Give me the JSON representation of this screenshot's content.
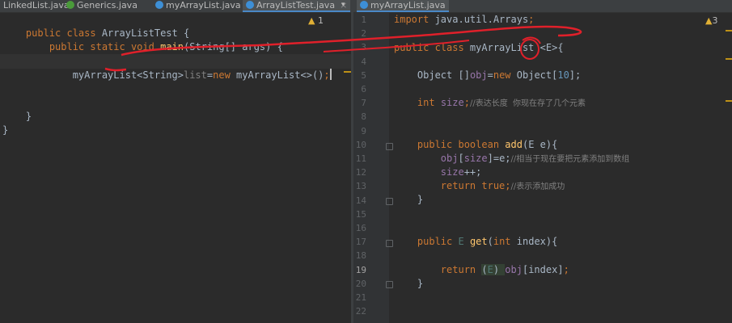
{
  "left_tabs": [
    {
      "label": "LinkedList.java",
      "icon": "java-class-icon"
    },
    {
      "label": "Generics.java",
      "icon": "java-generic-icon"
    },
    {
      "label": "myArrayList.java",
      "icon": "java-class-icon"
    },
    {
      "label": "ArrayListTest.java",
      "icon": "java-class-icon",
      "active": true,
      "close": "×"
    }
  ],
  "right_tabs": [
    {
      "label": "myArrayList.java",
      "icon": "java-class-icon",
      "active": true
    }
  ],
  "left_editor": {
    "warnings": "1",
    "lines": [
      "public class ArrayListTest {",
      "    public static void main(String[] args) {",
      "",
      "        myArrayList<String>list=new myArrayList<>();",
      "",
      "",
      "",
      "    }",
      "}"
    ]
  },
  "right_editor": {
    "warnings": "3",
    "line_numbers": [
      "1",
      "2",
      "3",
      "4",
      "5",
      "6",
      "7",
      "8",
      "9",
      "10",
      "11",
      "12",
      "13",
      "14",
      "15",
      "16",
      "17",
      "18",
      "19",
      "20",
      "21",
      "22"
    ],
    "code": {
      "l1": "import java.util.Arrays;",
      "l3a": "public class ",
      "l3b": "myArrayList ",
      "l3c": "<E>",
      "l3d": "{",
      "l5a": "Object []",
      "l5b": "obj",
      "l5c": "=",
      "l5d": "new ",
      "l5e": "Object[",
      "l5f": "10",
      "l5g": "];",
      "l7a": "int ",
      "l7b": "size",
      "l7c": ";",
      "l7d": "//表达长度  你现在存了几个元素",
      "l10a": "public boolean ",
      "l10b": "add",
      "l10c": "(E e){",
      "l11a": "obj",
      "l11b": "[",
      "l11c": "size",
      "l11d": "]=e;",
      "l11e": "//相当于现在要把元素添加到数组",
      "l12a": "size",
      "l12b": "++;",
      "l13a": "return true;",
      "l13b": "//表示添加成功",
      "l14": "}",
      "l17a": "public ",
      "l17b": "E ",
      "l17c": "get",
      "l17d": "(",
      "l17e": "int ",
      "l17f": "index){",
      "l19a": "return ",
      "l19b": "(",
      "l19c": "E",
      "l19d": ") ",
      "l19e": "obj",
      "l19f": "[index]",
      "l19g": ";",
      "l20": "}"
    }
  }
}
